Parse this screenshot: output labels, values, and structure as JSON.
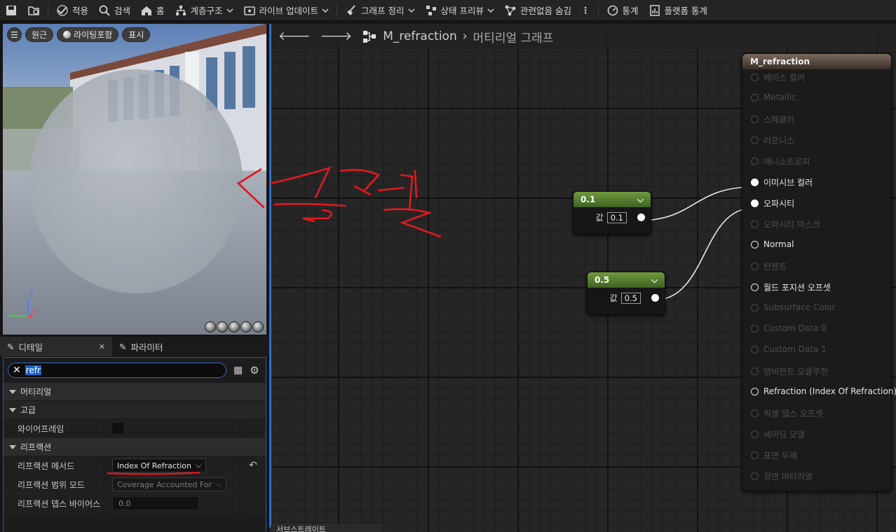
{
  "toolbar": {
    "apply": "적용",
    "search": "검색",
    "home": "홈",
    "hierarchy": "계층구조",
    "live_update": "라이브 업데이트",
    "graph_clean": "그래프 정리",
    "state_preview": "상태 프리뷰",
    "hide_unrelated": "관련없음 숨김",
    "stats": "통계",
    "platform_stats": "플랫폼 통계"
  },
  "viewport": {
    "perspective": "원근",
    "lit": "라이팅포함",
    "show": "표시",
    "axis_z": "Z",
    "axis_x": "X"
  },
  "details": {
    "tab_details": "디테일",
    "tab_params": "파라미터",
    "search_value": "refr",
    "cat_material": "머티리얼",
    "cat_advanced": "고급",
    "wireframe_label": "와이어프레임",
    "cat_refraction": "리프랙션",
    "refraction_method_label": "리프랙션 메서드",
    "refraction_method_value": "Index Of Refraction",
    "refraction_coverage_label": "리프랙션 범위 모드",
    "refraction_coverage_value": "Coverage Accounted For",
    "refraction_depth_label": "리프랙션 뎁스 바이어스",
    "refraction_depth_value": "0.0"
  },
  "graph": {
    "material_name": "M_refraction",
    "graph_label": "머티리얼 그래프",
    "node1": {
      "title": "0.1",
      "value_label": "값",
      "value": "0.1"
    },
    "node2": {
      "title": "0.5",
      "value_label": "값",
      "value": "0.5"
    },
    "output_title": "M_refraction",
    "output_pins": [
      {
        "label": "베이스 컬러",
        "active": false
      },
      {
        "label": "Metallic",
        "active": false
      },
      {
        "label": "스페큘러",
        "active": false
      },
      {
        "label": "러프니스",
        "active": false
      },
      {
        "label": "애니소트로피",
        "active": false
      },
      {
        "label": "이미시브 컬러",
        "active": true,
        "connected": true
      },
      {
        "label": "오파시티",
        "active": true,
        "connected": true
      },
      {
        "label": "오파시티 마스크",
        "active": false
      },
      {
        "label": "Normal",
        "active": true
      },
      {
        "label": "탄젠트",
        "active": false
      },
      {
        "label": "월드 포지션 오프셋",
        "active": true
      },
      {
        "label": "Subsurface Color",
        "active": false
      },
      {
        "label": "Custom Data 0",
        "active": false
      },
      {
        "label": "Custom Data 1",
        "active": false
      },
      {
        "label": "앰비언트 오클루전",
        "active": false
      },
      {
        "label": "Refraction (Index Of Refraction)",
        "active": true
      },
      {
        "label": "픽셀 뎁스 오프셋",
        "active": false
      },
      {
        "label": "셰이딩 모델",
        "active": false
      },
      {
        "label": "표면 두께",
        "active": false
      },
      {
        "label": "정면 머티리얼",
        "active": false
      }
    ]
  },
  "annotation": {
    "handwriting": "굴절"
  },
  "bottom_tab": "서브스트레이트"
}
